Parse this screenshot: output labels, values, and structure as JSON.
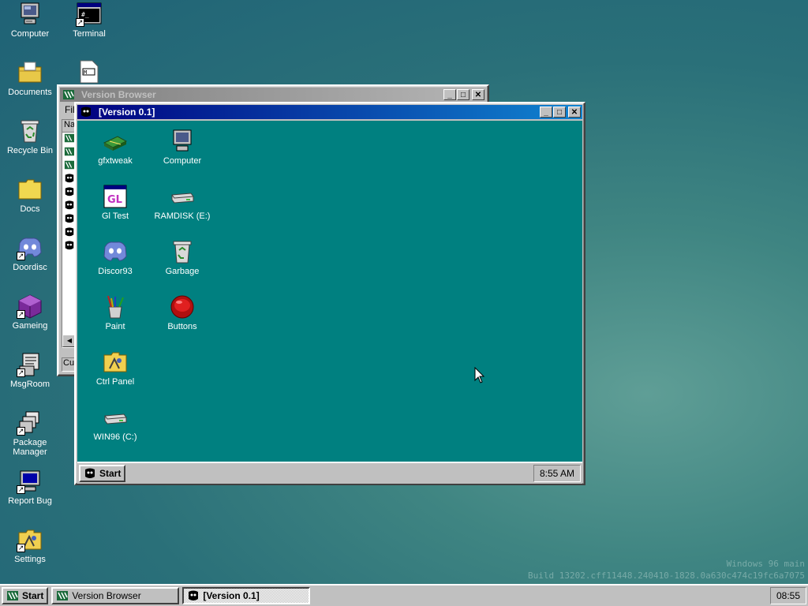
{
  "desktop_icons": [
    {
      "label": "Computer",
      "icon": "computer-icon"
    },
    {
      "label": "Terminal",
      "icon": "terminal-icon"
    },
    {
      "label": "Documents",
      "icon": "folder-icon"
    },
    {
      "label": "Recycle Bin",
      "icon": "recycle-bin-icon"
    },
    {
      "label": "Docs",
      "icon": "folder-icon"
    },
    {
      "label": "Doordisc",
      "icon": "discord-icon"
    },
    {
      "label": "Gameing",
      "icon": "cube-icon"
    },
    {
      "label": "MsgRoom",
      "icon": "msgroom-icon"
    },
    {
      "label": "Package Manager",
      "icon": "package-icon"
    },
    {
      "label": "Report Bug",
      "icon": "monitor-icon"
    },
    {
      "label": "Settings",
      "icon": "control-panel-icon"
    }
  ],
  "version_browser": {
    "title": "Version Browser",
    "menu_file": "File",
    "col_name": "Na",
    "status": "Cur",
    "list_row_count": 9
  },
  "inner_window": {
    "title": "[Version 0.1]",
    "icons": [
      {
        "label": "gfxtweak",
        "icon": "gfxtweak-icon"
      },
      {
        "label": "Computer",
        "icon": "computer-icon"
      },
      {
        "label": "Gl Test",
        "icon": "gl-test-icon"
      },
      {
        "label": "RAMDISK (E:)",
        "icon": "drive-icon"
      },
      {
        "label": "Discor93",
        "icon": "discord-icon"
      },
      {
        "label": "Garbage",
        "icon": "recycle-bin-icon"
      },
      {
        "label": "Paint",
        "icon": "paint-icon"
      },
      {
        "label": "Buttons",
        "icon": "red-button-icon"
      },
      {
        "label": "Ctrl Panel",
        "icon": "control-panel-icon"
      },
      {
        "label": "WIN96 (C:)",
        "icon": "drive-icon"
      }
    ],
    "start_label": "Start",
    "clock": "8:55 AM"
  },
  "taskbar": {
    "start_label": "Start",
    "tasks": [
      {
        "label": "Version Browser",
        "active": false
      },
      {
        "label": "[Version 0.1]",
        "active": true
      }
    ],
    "clock": "08:55"
  },
  "watermark": {
    "line1": "Windows 96 main",
    "line2": "Build 13202.cff11448.240410-1828.0a630c474c19fc6a7075"
  },
  "colors": {
    "desktop_teal": "#2a7079",
    "inner_desktop": "#008080",
    "title_active": "#000080",
    "title_inactive": "#808080",
    "chrome": "#c0c0c0"
  }
}
